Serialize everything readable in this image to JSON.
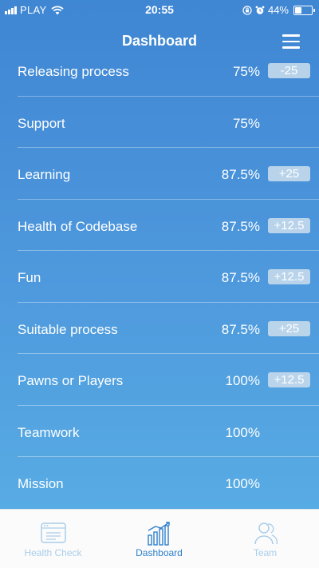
{
  "status_bar": {
    "carrier": "PLAY",
    "time": "20:55",
    "battery": "44%",
    "battery_level": 0.44
  },
  "nav": {
    "title": "Dashboard",
    "menu_icon": "hamburger-menu-icon"
  },
  "metrics": [
    {
      "name": "Releasing process",
      "value": "75%",
      "delta": "-25"
    },
    {
      "name": "Support",
      "value": "75%",
      "delta": ""
    },
    {
      "name": "Learning",
      "value": "87.5%",
      "delta": "+25"
    },
    {
      "name": "Health of Codebase",
      "value": "87.5%",
      "delta": "+12.5"
    },
    {
      "name": "Fun",
      "value": "87.5%",
      "delta": "+12.5"
    },
    {
      "name": "Suitable process",
      "value": "87.5%",
      "delta": "+25"
    },
    {
      "name": "Pawns or Players",
      "value": "100%",
      "delta": "+12.5"
    },
    {
      "name": "Teamwork",
      "value": "100%",
      "delta": ""
    },
    {
      "name": "Mission",
      "value": "100%",
      "delta": ""
    }
  ],
  "tabs": [
    {
      "label": "Health Check",
      "icon": "health-check-icon",
      "active": false
    },
    {
      "label": "Dashboard",
      "icon": "chart-icon",
      "active": true
    },
    {
      "label": "Team",
      "icon": "team-icon",
      "active": false
    }
  ],
  "colors": {
    "background_top": "#3f86d3",
    "background_bottom": "#5ab0e6",
    "tab_active": "#2f80cc",
    "tab_inactive": "#a9cdea"
  }
}
